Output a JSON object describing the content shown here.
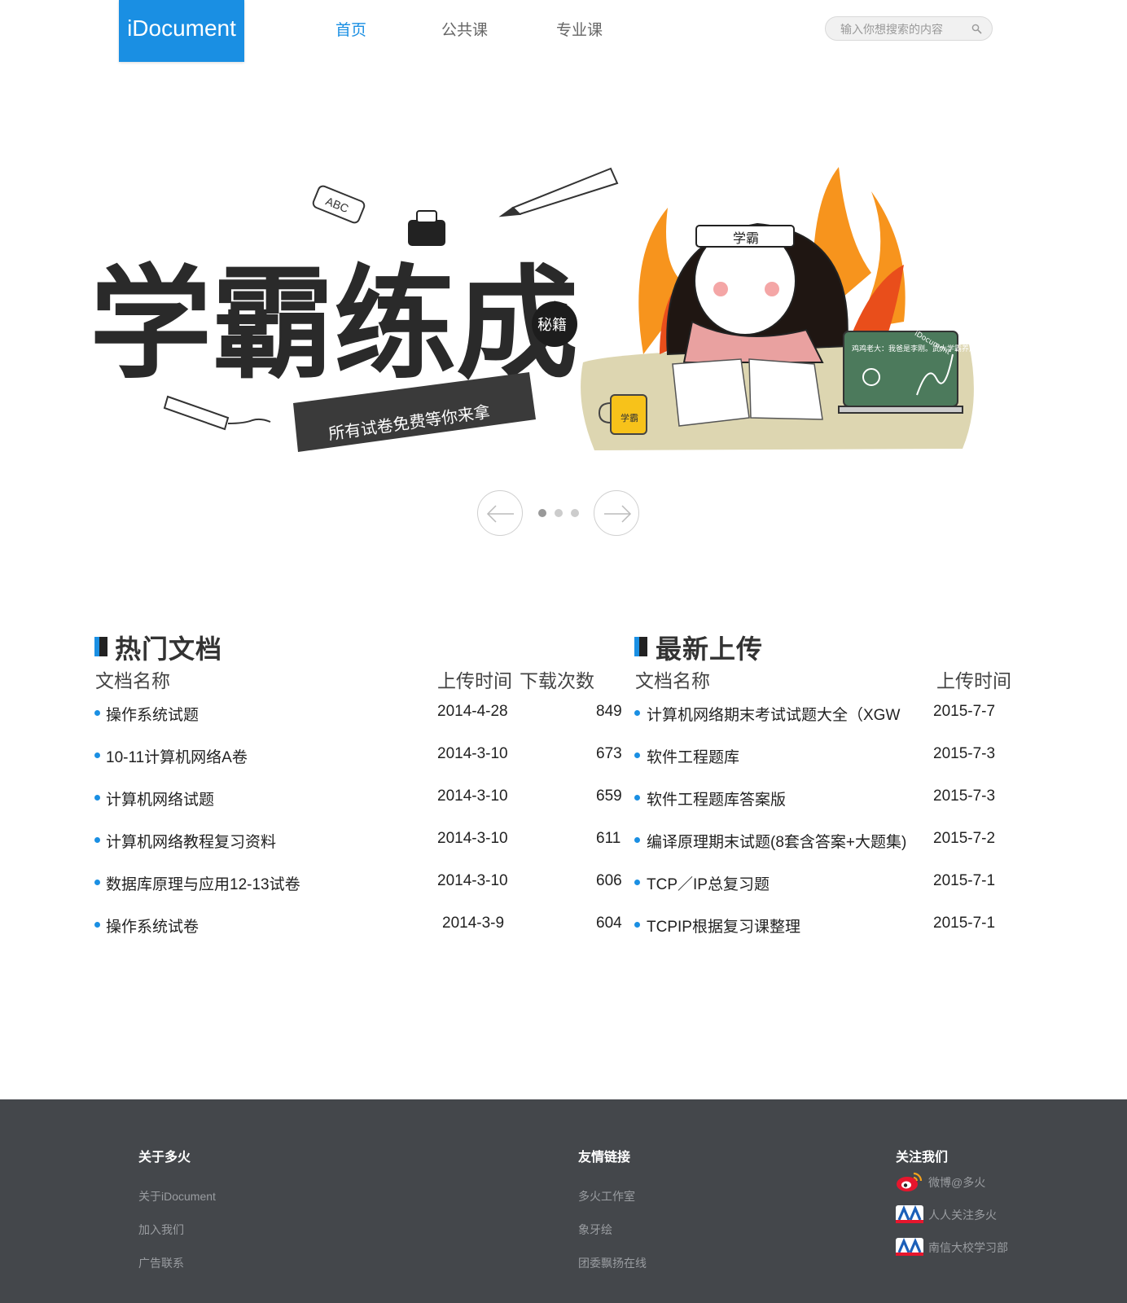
{
  "header": {
    "logo": "iDocument",
    "nav": [
      "首页",
      "公共课",
      "专业课"
    ],
    "search_placeholder": "输入你想搜索的内容"
  },
  "banner": {
    "headline": "学霸练成",
    "seal": "秘籍",
    "subtitle": "所有试卷免费等你来拿",
    "headband": "学霸",
    "mug": "学霸",
    "board_text": "鸡鸡老大：我爸是李刚。武大学霸养成。",
    "board_brand": "iDocument",
    "slides": 3,
    "active_slide": 1
  },
  "hot": {
    "title": "热门文档",
    "col_name": "文档名称",
    "col_time": "上传时间",
    "col_count": "下载次数",
    "rows": [
      {
        "name": "操作系统试题",
        "date": "2014-4-28",
        "count": "849"
      },
      {
        "name": "10-11计算机网络A卷",
        "date": "2014-3-10",
        "count": "673"
      },
      {
        "name": "计算机网络试题",
        "date": "2014-3-10",
        "count": "659"
      },
      {
        "name": "计算机网络教程复习资料",
        "date": "2014-3-10",
        "count": "611"
      },
      {
        "name": "数据库原理与应用12-13试卷",
        "date": "2014-3-10",
        "count": "606"
      },
      {
        "name": "操作系统试卷",
        "date": "2014-3-9",
        "count": "604"
      }
    ]
  },
  "latest": {
    "title": "最新上传",
    "col_name": "文档名称",
    "col_time": "上传时间",
    "rows": [
      {
        "name": "计算机网络期末考试试题大全（XGW",
        "date": "2015-7-7"
      },
      {
        "name": "软件工程题库",
        "date": "2015-7-3"
      },
      {
        "name": "软件工程题库答案版",
        "date": "2015-7-3"
      },
      {
        "name": "编译原理期末试题(8套含答案+大题集)",
        "date": "2015-7-2"
      },
      {
        "name": "TCP／IP总复习题",
        "date": "2015-7-1"
      },
      {
        "name": "TCPIP根据复习课整理",
        "date": "2015-7-1"
      }
    ]
  },
  "footer": {
    "about": {
      "title": "关于多火",
      "links": [
        "关于iDocument",
        "加入我们",
        "广告联系"
      ]
    },
    "friends": {
      "title": "友情链接",
      "links": [
        "多火工作室",
        "象牙绘",
        "团委飘扬在线"
      ]
    },
    "follow": {
      "title": "关注我们",
      "links": [
        "微博@多火",
        "人人关注多火",
        "南信大校学习部"
      ]
    }
  },
  "colors": {
    "accent": "#1a8fe3",
    "footer_bg": "#44474b"
  }
}
